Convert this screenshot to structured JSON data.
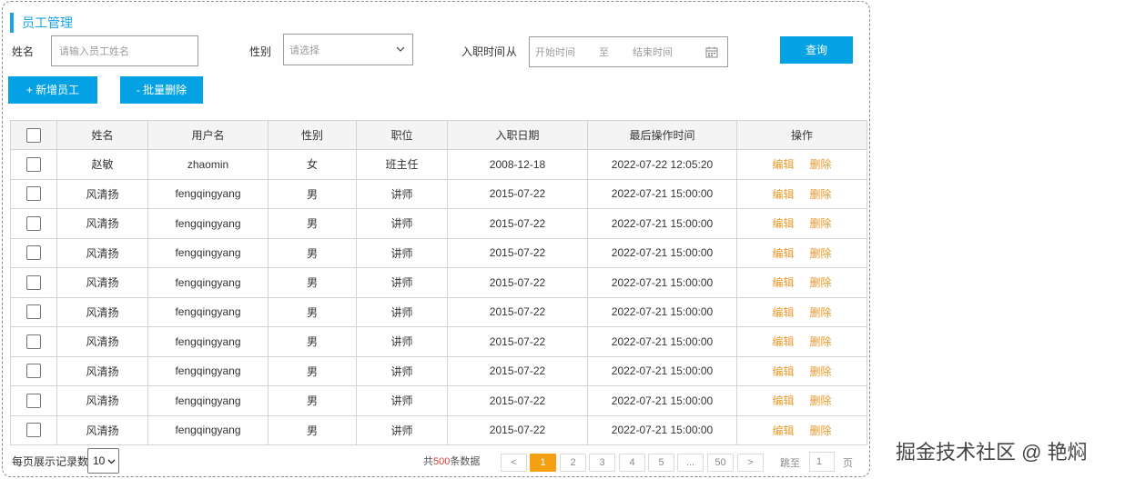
{
  "panel": {
    "title": "员工管理"
  },
  "filters": {
    "name_label": "姓名",
    "name_placeholder": "请输入员工姓名",
    "gender_label": "性别",
    "gender_placeholder": "请选择",
    "date_label": "入职时间",
    "date_from": "从",
    "date_start_placeholder": "开始时间",
    "date_to": "至",
    "date_end_placeholder": "结束时间",
    "query_button": "查询"
  },
  "actions": {
    "add_button": "+ 新增员工",
    "batch_delete_button": "- 批量删除"
  },
  "table": {
    "headers": [
      "姓名",
      "用户名",
      "性别",
      "职位",
      "入职日期",
      "最后操作时间",
      "操作"
    ],
    "edit_label": "编辑",
    "delete_label": "删除",
    "rows": [
      {
        "name": "赵敏",
        "username": "zhaomin",
        "gender": "女",
        "position": "班主任",
        "hire_date": "2008-12-18",
        "last_op": "2022-07-22 12:05:20"
      },
      {
        "name": "风清扬",
        "username": "fengqingyang",
        "gender": "男",
        "position": "讲师",
        "hire_date": "2015-07-22",
        "last_op": "2022-07-21 15:00:00"
      },
      {
        "name": "风清扬",
        "username": "fengqingyang",
        "gender": "男",
        "position": "讲师",
        "hire_date": "2015-07-22",
        "last_op": "2022-07-21 15:00:00"
      },
      {
        "name": "风清扬",
        "username": "fengqingyang",
        "gender": "男",
        "position": "讲师",
        "hire_date": "2015-07-22",
        "last_op": "2022-07-21 15:00:00"
      },
      {
        "name": "风清扬",
        "username": "fengqingyang",
        "gender": "男",
        "position": "讲师",
        "hire_date": "2015-07-22",
        "last_op": "2022-07-21 15:00:00"
      },
      {
        "name": "风清扬",
        "username": "fengqingyang",
        "gender": "男",
        "position": "讲师",
        "hire_date": "2015-07-22",
        "last_op": "2022-07-21 15:00:00"
      },
      {
        "name": "风清扬",
        "username": "fengqingyang",
        "gender": "男",
        "position": "讲师",
        "hire_date": "2015-07-22",
        "last_op": "2022-07-21 15:00:00"
      },
      {
        "name": "风清扬",
        "username": "fengqingyang",
        "gender": "男",
        "position": "讲师",
        "hire_date": "2015-07-22",
        "last_op": "2022-07-21 15:00:00"
      },
      {
        "name": "风清扬",
        "username": "fengqingyang",
        "gender": "男",
        "position": "讲师",
        "hire_date": "2015-07-22",
        "last_op": "2022-07-21 15:00:00"
      },
      {
        "name": "风清扬",
        "username": "fengqingyang",
        "gender": "男",
        "position": "讲师",
        "hire_date": "2015-07-22",
        "last_op": "2022-07-21 15:00:00"
      }
    ]
  },
  "pagination": {
    "page_size_label": "每页展示记录数",
    "page_size_value": "10",
    "total_prefix": "共",
    "total_count": "500",
    "total_suffix": "条数据",
    "prev": "<",
    "pages": [
      "1",
      "2",
      "3",
      "4",
      "5"
    ],
    "ellipsis": "...",
    "last_page": "50",
    "next": ">",
    "jump_label": "跳至",
    "jump_value": "1",
    "page_unit": "页",
    "active_page": "1"
  },
  "watermark": "掘金技术社区 @ 艳焖",
  "colors": {
    "accent": "#04a2e4",
    "link": "#ec9a2b",
    "active_page": "#f5a013",
    "total_count": "#e53935"
  }
}
